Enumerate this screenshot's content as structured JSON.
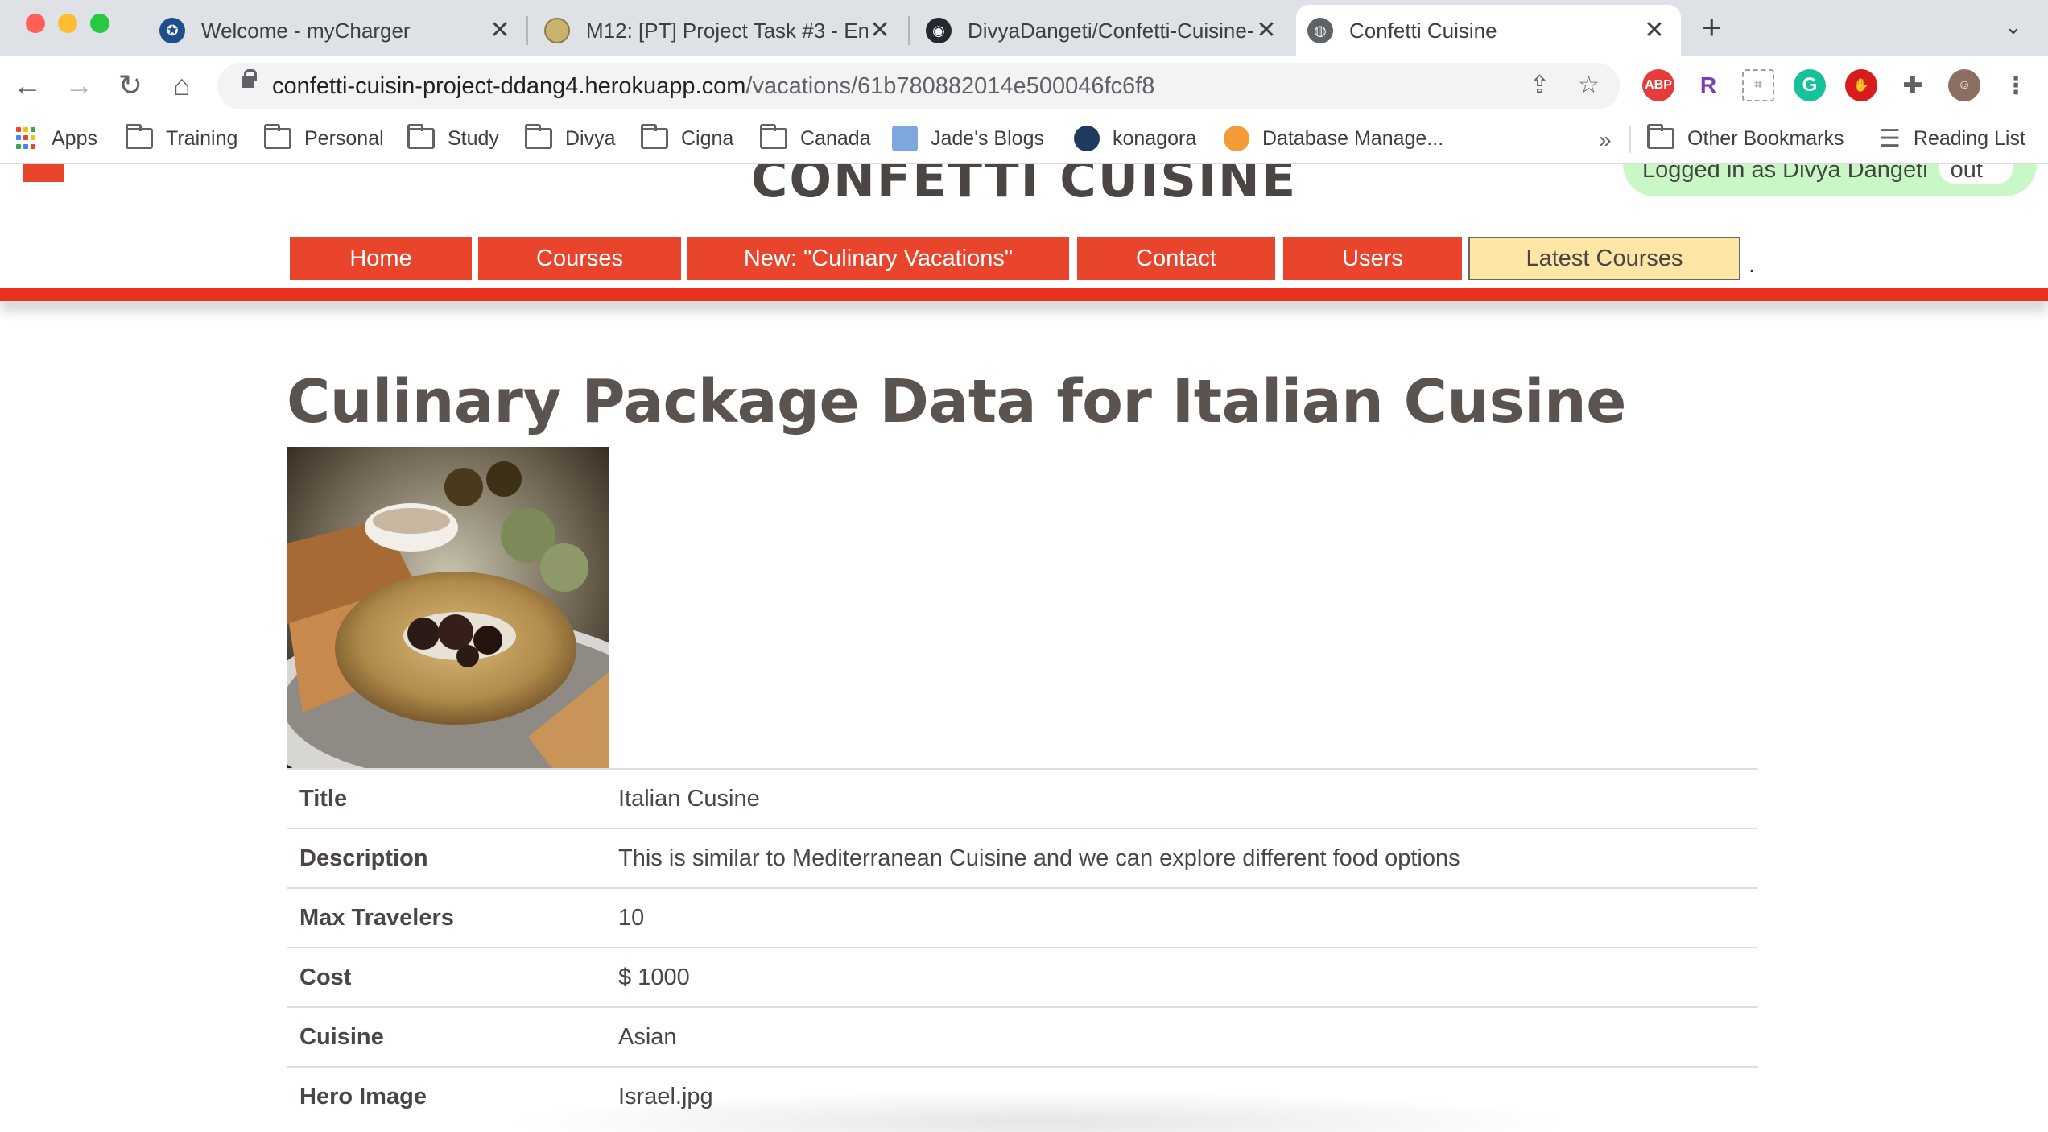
{
  "browser": {
    "tabs": [
      {
        "title": "Welcome - myCharger",
        "icon": "mycharger-icon"
      },
      {
        "title": "M12: [PT] Project Task #3 - En",
        "icon": "university-seal-icon"
      },
      {
        "title": "DivyaDangeti/Confetti-Cuisine-",
        "icon": "github-icon"
      },
      {
        "title": "Confetti Cuisine",
        "icon": "globe-icon",
        "active": true
      }
    ],
    "url_host": "confetti-cuisin-project-ddang4.herokuapp.com",
    "url_path": "/vacations/61b780882014e500046fc6f8",
    "extensions": [
      {
        "name": "adblock-plus-icon",
        "text": "ABP",
        "color": "#e63b3b"
      },
      {
        "name": "r-extension-icon",
        "text": "R",
        "color": "#7b3fb4"
      },
      {
        "name": "grammarly-icon",
        "text": "G",
        "color": "#15c39a"
      },
      {
        "name": "ublock-icon",
        "text": "",
        "color": "#d81b1b"
      }
    ],
    "bookmarks": [
      {
        "label": "Apps",
        "icon": "apps-grid-icon"
      },
      {
        "label": "Training",
        "icon": "folder-icon"
      },
      {
        "label": "Personal",
        "icon": "folder-icon"
      },
      {
        "label": "Study",
        "icon": "folder-icon"
      },
      {
        "label": "Divya",
        "icon": "folder-icon"
      },
      {
        "label": "Cigna",
        "icon": "folder-icon"
      },
      {
        "label": "Canada",
        "icon": "folder-icon"
      },
      {
        "label": "Jade's Blogs",
        "icon": "blog-icon"
      },
      {
        "label": "konagora",
        "icon": "konagora-icon"
      },
      {
        "label": "Database Manage...",
        "icon": "database-icon"
      }
    ],
    "bookmarks_overflow": "»",
    "other_bookmarks": "Other Bookmarks",
    "reading_list": "Reading List"
  },
  "site": {
    "title": "CONFETTI CUISINE",
    "login_text": "Logged in as Divya Dangeti",
    "logout_label": "Log out",
    "nav": [
      {
        "label": "Home"
      },
      {
        "label": "Courses"
      },
      {
        "label": "New: \"Culinary Vacations\""
      },
      {
        "label": "Contact"
      },
      {
        "label": "Users"
      },
      {
        "label": "Latest Courses"
      }
    ],
    "nav_trailing": ".",
    "accent_color": "#e8452c"
  },
  "main": {
    "heading": "Culinary Package Data for Italian Cusine",
    "details": [
      {
        "label": "Title",
        "value": "Italian Cusine"
      },
      {
        "label": "Description",
        "value": "This is similar to Mediterranean Cuisine and we can explore different food options"
      },
      {
        "label": "Max Travelers",
        "value": "10"
      },
      {
        "label": "Cost",
        "value": "$ 1000"
      },
      {
        "label": "Cuisine",
        "value": "Asian"
      },
      {
        "label": "Hero Image",
        "value": "Israel.jpg"
      }
    ]
  }
}
